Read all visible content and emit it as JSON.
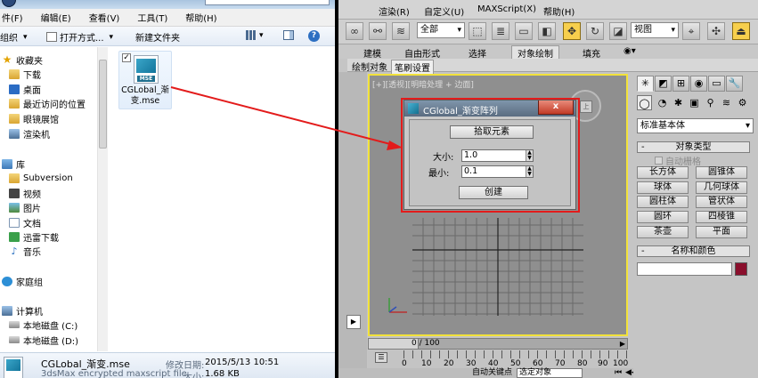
{
  "explorer": {
    "menu": [
      "件(F)",
      "编辑(E)",
      "查看(V)",
      "工具(T)",
      "帮助(H)"
    ],
    "toolbar": {
      "organize": "组织",
      "open_with": "打开方式...",
      "new_folder": "新建文件夹"
    },
    "nav": {
      "favorites_header": "收藏夹",
      "favorites": [
        "下载",
        "桌面",
        "最近访问的位置",
        "眼镜展馆",
        "渲染机"
      ],
      "library_header": "库",
      "library": [
        "Subversion",
        "视频",
        "图片",
        "文档",
        "迅雷下载",
        "音乐"
      ],
      "homegroup": "家庭组",
      "computer_header": "计算机",
      "drives": [
        "本地磁盘 (C:)",
        "本地磁盘 (D:)"
      ]
    },
    "file": {
      "name_line1": "CGLobal_渐",
      "name_line2": "变.mse",
      "icon_label": "MSE",
      "checked_mark": "✓"
    },
    "details": {
      "name": "CGLobal_渐变.mse",
      "type": "3dsMax encrypted maxscript file",
      "modified_label": "修改日期:",
      "modified": "2015/5/13 10:51",
      "size_label": "大小:",
      "size": "1.68 KB"
    }
  },
  "max": {
    "menu": [
      "渲染(R)",
      "自定义(U)",
      "MAXScript(X)",
      "帮助(H)"
    ],
    "toolbar": {
      "filter": "全部",
      "view": "视图"
    },
    "ribbon_tabs": [
      "建模",
      "自由形式",
      "选择",
      "对象绘制",
      "填充"
    ],
    "ribbon_active_tab": "对象绘制",
    "ribbon_subtabs": [
      "绘制对象",
      "笔刷设置"
    ],
    "viewport_label": "[+][透视][明暗处理 + 边面]",
    "viewcube_face": "上",
    "timeline": {
      "position": "0 / 100",
      "ticks": [
        "0",
        "10",
        "20",
        "30",
        "40",
        "50",
        "60",
        "70",
        "80",
        "90",
        "100"
      ]
    },
    "status_text": "自动关键点",
    "status_select": "选定对象",
    "command_panel": {
      "dropdown": "标准基本体",
      "object_type_header": "对象类型",
      "autogrid": "自动栅格",
      "objects": [
        "长方体",
        "圆锥体",
        "球体",
        "几何球体",
        "圆柱体",
        "管状体",
        "圆环",
        "四棱锥",
        "茶壶",
        "平面"
      ],
      "name_color_header": "名称和颜色",
      "object_color": "#8a0f2c"
    },
    "dialog": {
      "title": "CGlobal_渐变阵列",
      "close": "x",
      "pick_button": "拾取元素",
      "size_label": "大小:",
      "size_value": "1.0",
      "min_label": "最小:",
      "min_value": "0.1",
      "create_button": "创建"
    }
  },
  "colors": {
    "highlight_red": "#e31b1b",
    "viewport_active": "#f2e23a"
  }
}
